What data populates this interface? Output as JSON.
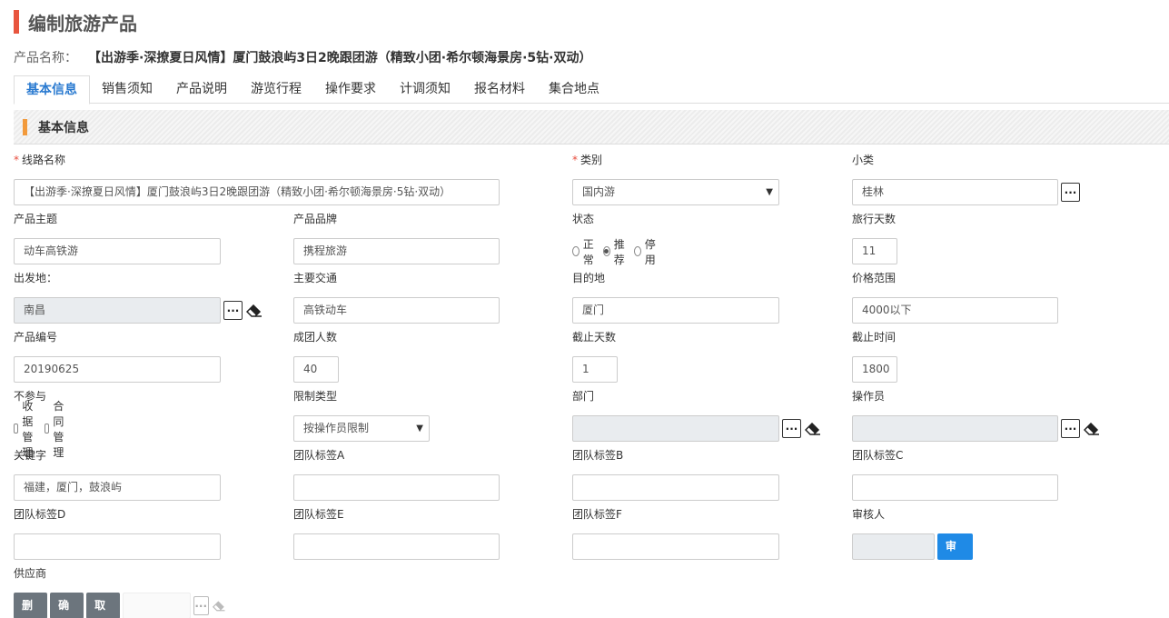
{
  "page": {
    "title": "编制旅游产品",
    "product_name_label": "产品名称：",
    "product_name": "【出游季·深撩夏日风情】厦门鼓浪屿3日2晚跟团游（精致小团·希尔顿海景房·5钻·双动）"
  },
  "tabs": [
    "基本信息",
    "销售须知",
    "产品说明",
    "游览行程",
    "操作要求",
    "计调须知",
    "报名材料",
    "集合地点"
  ],
  "section": {
    "title": "基本信息"
  },
  "form": {
    "route_name": {
      "label": "线路名称",
      "value": "【出游季·深撩夏日风情】厦门鼓浪屿3日2晚跟团游（精致小团·希尔顿海景房·5钻·双动）"
    },
    "category": {
      "label": "类别",
      "value": "国内游"
    },
    "subcategory": {
      "label": "小类",
      "value": "桂林"
    },
    "theme": {
      "label": "产品主题",
      "value": "动车高铁游"
    },
    "brand": {
      "label": "产品品牌",
      "value": "携程旅游"
    },
    "status": {
      "label": "状态",
      "options": [
        "正常",
        "推荐",
        "停用"
      ],
      "selected": "推荐"
    },
    "travel_days": {
      "label": "旅行天数",
      "value": "11"
    },
    "departure": {
      "label": "出发地：",
      "value": "南昌"
    },
    "transport": {
      "label": "主要交通",
      "value": "高铁动车"
    },
    "destination": {
      "label": "目的地",
      "value": "厦门"
    },
    "price_range": {
      "label": "价格范围",
      "value": "4000以下"
    },
    "product_code": {
      "label": "产品编号",
      "value": "20190625"
    },
    "group_size": {
      "label": "成团人数",
      "value": "40"
    },
    "cutoff_days": {
      "label": "截止天数",
      "value": "1"
    },
    "cutoff_time": {
      "label": "截止时间",
      "value": "1800"
    },
    "exclude": {
      "label": "不参与",
      "options": [
        "收据管理",
        "合同管理"
      ]
    },
    "restrict_type": {
      "label": "限制类型",
      "value": "按操作员限制"
    },
    "department": {
      "label": "部门",
      "value": ""
    },
    "operator": {
      "label": "操作员",
      "value": ""
    },
    "keywords": {
      "label": "关键字",
      "value": "福建，厦门，鼓浪屿"
    },
    "tag_a": {
      "label": "团队标签A",
      "value": ""
    },
    "tag_b": {
      "label": "团队标签B",
      "value": ""
    },
    "tag_c": {
      "label": "团队标签C",
      "value": ""
    },
    "tag_d": {
      "label": "团队标签D",
      "value": ""
    },
    "tag_e": {
      "label": "团队标签E",
      "value": ""
    },
    "tag_f": {
      "label": "团队标签F",
      "value": ""
    },
    "reviewer": {
      "label": "审核人",
      "value": "",
      "button": "审核"
    },
    "supplier": {
      "label": "供应商",
      "value": ""
    }
  },
  "actions": {
    "delete": "删除",
    "confirm": "确定",
    "cancel": "取消"
  },
  "colors": {
    "accent_red": "#e8553e",
    "accent_orange": "#f29a3c",
    "primary_blue": "#1f8ae6",
    "active_tab": "#2a7ad0",
    "gray_button": "#6c757d"
  },
  "icons": {
    "more": "ellipsis-icon",
    "clear": "eraser-icon",
    "dropdown": "caret-down-icon"
  }
}
